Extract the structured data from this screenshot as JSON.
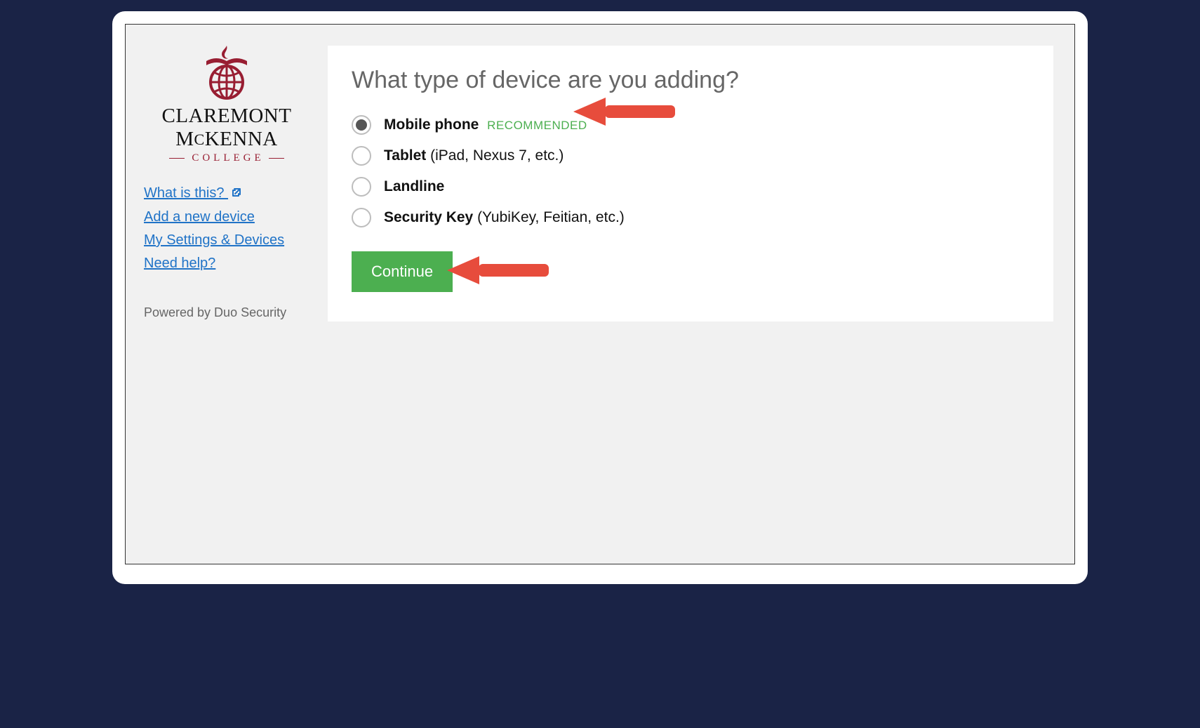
{
  "logo": {
    "line1": "CLAREMONT",
    "line2_pre": "M",
    "line2_small": "C",
    "line2_post": "KENNA",
    "college": "COLLEGE"
  },
  "sidebar": {
    "links": {
      "what_is_this": "What is this?",
      "add_device": "Add a new device",
      "settings": "My Settings & Devices",
      "need_help": "Need help?"
    },
    "powered_by": "Powered by Duo Security"
  },
  "main": {
    "title": "What type of device are you adding?",
    "options": [
      {
        "label": "Mobile phone",
        "hint": "",
        "badge": "RECOMMENDED",
        "selected": true
      },
      {
        "label": "Tablet",
        "hint": " (iPad, Nexus 7, etc.)",
        "badge": "",
        "selected": false
      },
      {
        "label": "Landline",
        "hint": "",
        "badge": "",
        "selected": false
      },
      {
        "label": "Security Key",
        "hint": " (YubiKey, Feitian, etc.)",
        "badge": "",
        "selected": false
      }
    ],
    "continue_label": "Continue"
  },
  "colors": {
    "brand_maroon": "#981e32",
    "link_blue": "#2073c7",
    "button_green": "#4caf50",
    "arrow_red": "#e74c3c"
  }
}
